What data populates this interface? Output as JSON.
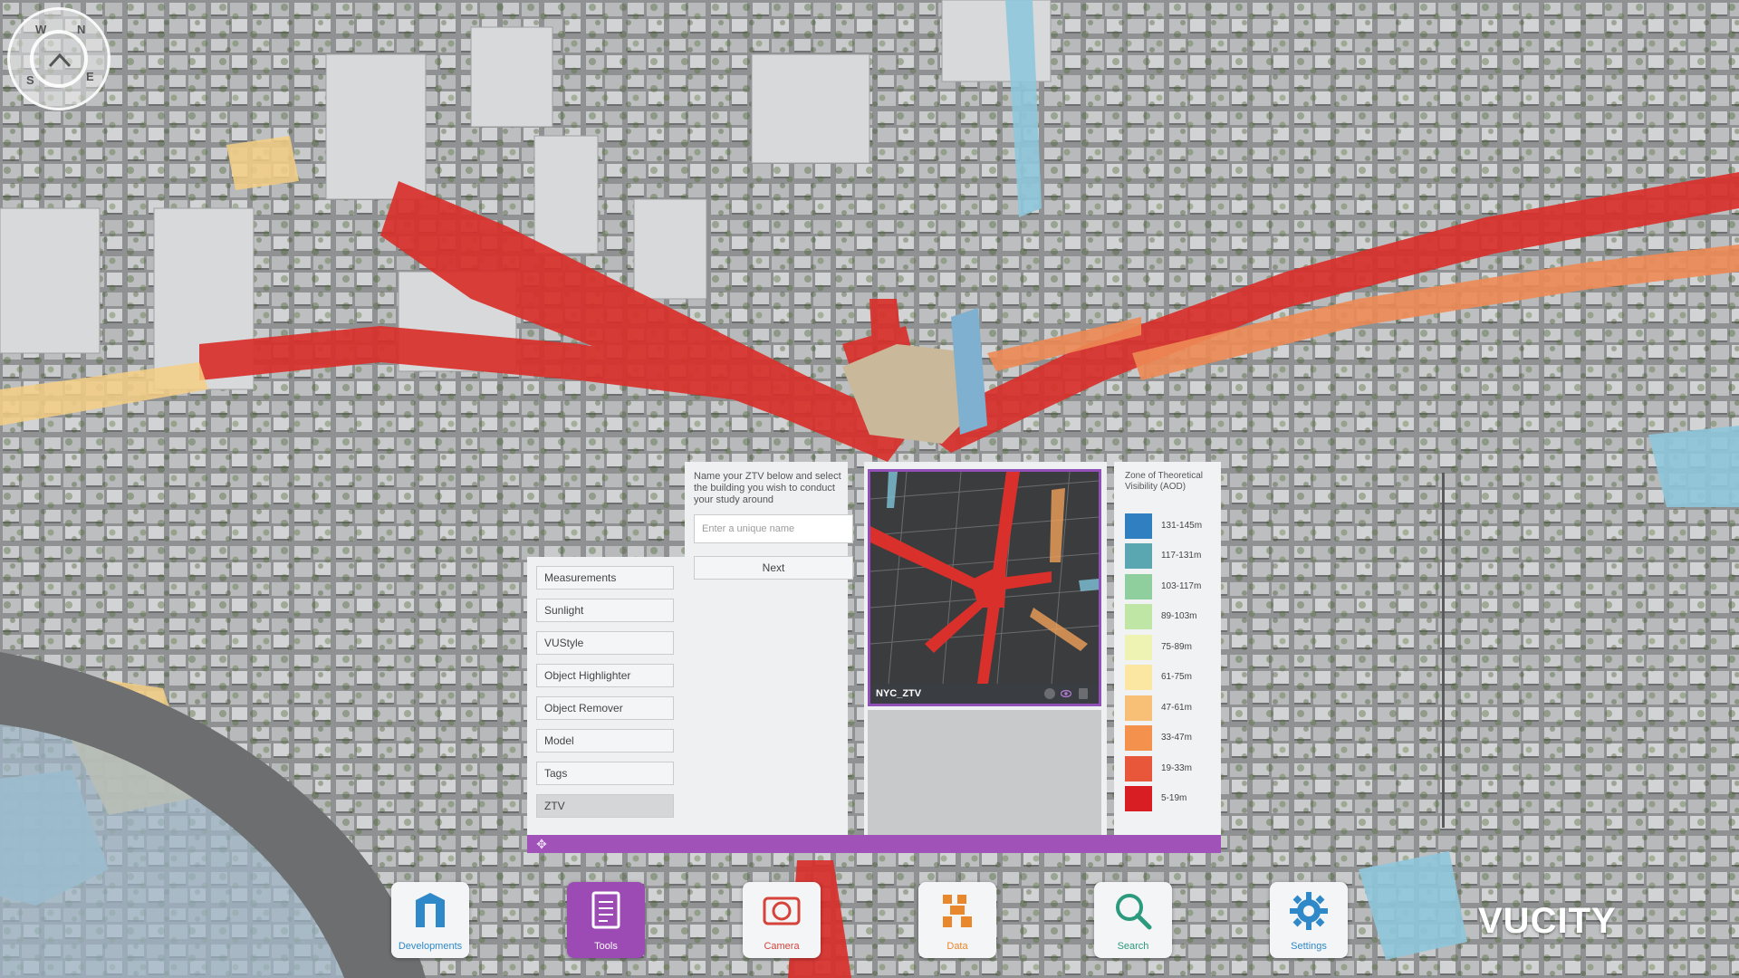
{
  "compass": {
    "letters": {
      "w": "W",
      "n": "N",
      "e": "E",
      "s": "S"
    }
  },
  "tools": {
    "items": [
      {
        "label": "Measurements"
      },
      {
        "label": "Sunlight"
      },
      {
        "label": "VUStyle"
      },
      {
        "label": "Object Highlighter"
      },
      {
        "label": "Object Remover"
      },
      {
        "label": "Model"
      },
      {
        "label": "Tags"
      },
      {
        "label": "ZTV",
        "active": true
      }
    ]
  },
  "ztv_form": {
    "description": "Name your ZTV below and select the building you wish to conduct your study around",
    "name_placeholder": "Enter a unique name",
    "next_label": "Next"
  },
  "result": {
    "name": "NYC_ZTV"
  },
  "legend": {
    "title": "Zone of Theoretical Visibility (AOD)",
    "entries": [
      {
        "label": "131-145m",
        "color": "#2f7fc1"
      },
      {
        "label": "117-131m",
        "color": "#5aa7b1"
      },
      {
        "label": "103-117m",
        "color": "#8fcf9e"
      },
      {
        "label": "89-103m",
        "color": "#bfe6a4"
      },
      {
        "label": "75-89m",
        "color": "#eef3b4"
      },
      {
        "label": "61-75m",
        "color": "#fbe6a2"
      },
      {
        "label": "47-61m",
        "color": "#f8bf77"
      },
      {
        "label": "33-47m",
        "color": "#f3914d"
      },
      {
        "label": "19-33m",
        "color": "#e8573a"
      },
      {
        "label": "5-19m",
        "color": "#d81e22"
      }
    ]
  },
  "dock": {
    "items": [
      {
        "label": "Developments",
        "icon": "developments-icon",
        "color": "#2f88c8"
      },
      {
        "label": "Tools",
        "icon": "tools-icon",
        "color": "#ffffff",
        "active": true
      },
      {
        "label": "Camera",
        "icon": "camera-icon",
        "color": "#d6433b"
      },
      {
        "label": "Data",
        "icon": "data-icon",
        "color": "#e9872c"
      },
      {
        "label": "Search",
        "icon": "search-icon",
        "color": "#2c9a7e"
      },
      {
        "label": "Settings",
        "icon": "gear-icon",
        "color": "#2f88c8"
      }
    ]
  },
  "brand": {
    "text": "VUCITY"
  },
  "accent": "#a052b8"
}
